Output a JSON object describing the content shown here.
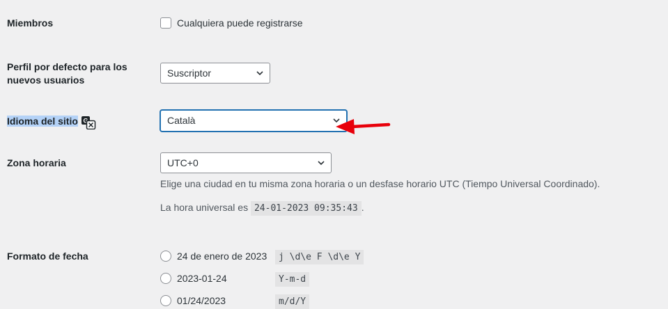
{
  "membership": {
    "label": "Miembros",
    "checkbox_label": "Cualquiera puede registrarse"
  },
  "default_role": {
    "label_line1": "Perfil por defecto para los",
    "label_line2": "nuevos usuarios",
    "value": "Suscriptor"
  },
  "site_language": {
    "label": "Idioma del sitio",
    "value": "Català"
  },
  "timezone": {
    "label": "Zona horaria",
    "value": "UTC+0",
    "description": "Elige una ciudad en tu misma zona horaria o un desfase horario UTC (Tiempo Universal Coordinado).",
    "universal_time_prefix": "La hora universal es",
    "universal_time_value": "24-01-2023 09:35:43",
    "universal_time_suffix": "."
  },
  "date_format": {
    "label": "Formato de fecha",
    "options": [
      {
        "label": "24 de enero de 2023",
        "code": "j \\d\\e F \\d\\e Y"
      },
      {
        "label": "2023-01-24",
        "code": "Y-m-d"
      },
      {
        "label": "01/24/2023",
        "code": "m/d/Y"
      }
    ]
  },
  "colors": {
    "background": "#f0f0f1",
    "focus": "#2271b1",
    "highlight": "#b4d2f7",
    "annotation_arrow": "#e8000b"
  },
  "icons": [
    "translate-icon",
    "chevron-down-icon",
    "red-arrow-annotation"
  ]
}
